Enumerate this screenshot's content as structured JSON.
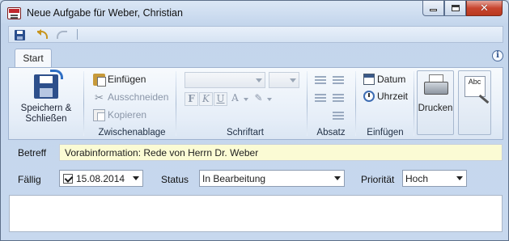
{
  "window": {
    "title": "Neue Aufgabe für Weber, Christian",
    "icon": "app-logo-icon",
    "controls": [
      "minimize-icon",
      "maximize-icon",
      "close-icon"
    ]
  },
  "quick_access": {
    "items": [
      "save-icon",
      "undo-icon",
      "redo-icon"
    ]
  },
  "ribbon": {
    "tabs": [
      {
        "label": "Start",
        "active": true
      }
    ],
    "help_icon": "info-icon",
    "groups": {
      "save": {
        "label": "Speichern & Schließen",
        "label_line1": "Speichern &",
        "label_line2": "Schließen"
      },
      "clipboard": {
        "label": "Zwischenablage",
        "paste": "Einfügen",
        "cut": "Ausschneiden",
        "copy": "Kopieren"
      },
      "font": {
        "label": "Schriftart",
        "font_name": "",
        "font_size": "",
        "buttons": [
          "F",
          "K",
          "U",
          "A"
        ]
      },
      "paragraph": {
        "label": "Absatz"
      },
      "insert": {
        "label": "Einfügen",
        "date": "Datum",
        "time": "Uhrzeit"
      },
      "print": {
        "label": "Drucken"
      },
      "spelling": {
        "icon_text": "Abc"
      }
    }
  },
  "form": {
    "subject_label": "Betreff",
    "subject_value": "Vorabinformation: Rede von Herrn Dr. Weber",
    "due_label": "Fällig",
    "due_checked": true,
    "due_value": "15.08.2014",
    "status_label": "Status",
    "status_value": "In Bearbeitung",
    "priority_label": "Priorität",
    "priority_value": "Hoch",
    "notes_value": ""
  },
  "colors": {
    "subject_background": "#fbfbd4",
    "close_button": "#c7452f",
    "frame": "#c9d9ec"
  }
}
